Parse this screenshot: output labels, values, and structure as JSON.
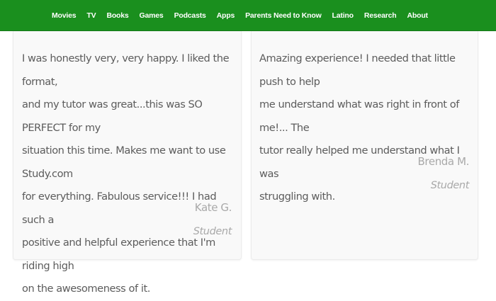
{
  "nav": {
    "items": [
      {
        "label": "Movies"
      },
      {
        "label": "TV"
      },
      {
        "label": "Books"
      },
      {
        "label": "Games"
      },
      {
        "label": "Podcasts"
      },
      {
        "label": "Apps"
      },
      {
        "label": "Parents Need to Know"
      },
      {
        "label": "Latino"
      },
      {
        "label": "Research"
      },
      {
        "label": "About"
      }
    ]
  },
  "colors": {
    "nav_background": "#1a8f1e",
    "nav_text": "#ffffff",
    "quote_text": "#5c5c5c",
    "attribution_text": "#a9a9a9",
    "card_background": "#f9f9f9"
  },
  "testimonials": [
    {
      "quote": "I was honestly very, very happy. I liked the format,\nand my tutor was great...this was SO PERFECT for my\nsituation this time. Makes me want to use Study.com\nfor everything. Fabulous service!!! I had such a\npositive and helpful experience that I'm riding high\non the awesomeness of it.",
      "author": "Kate G.",
      "role": "Student"
    },
    {
      "quote": "Amazing experience! I needed that little push to help\nme understand what was right in front of me!... The\ntutor really helped me understand what I was\nstruggling with.",
      "author": "Brenda M.",
      "role": "Student"
    }
  ]
}
